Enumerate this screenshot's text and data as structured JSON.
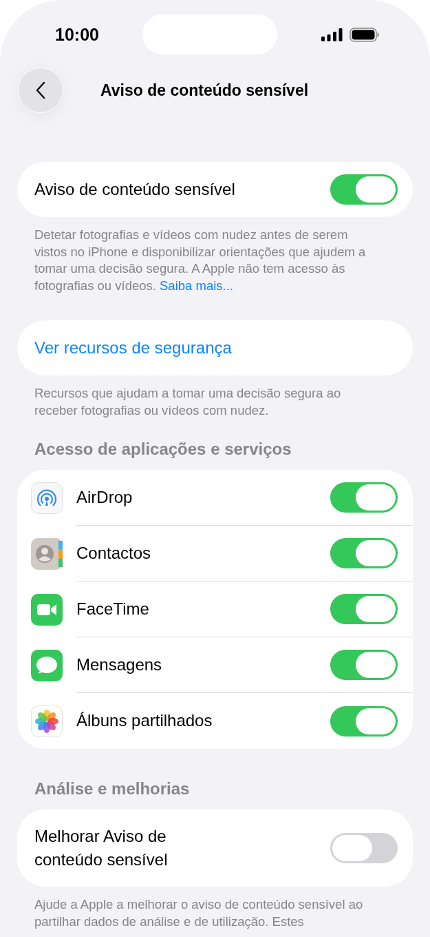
{
  "status_bar": {
    "time": "10:00"
  },
  "nav": {
    "title": "Aviso de conteúdo sensível"
  },
  "main_toggle": {
    "label": "Aviso de conteúdo sensível",
    "on": true
  },
  "main_footer": {
    "text": "Detetar fotografias e vídeos com nudez antes de serem vistos no iPhone e disponibilizar orientações que ajudem a tomar uma decisão segura. A Apple não tem acesso às fotografias ou vídeos.",
    "link": "Saiba mais..."
  },
  "resources": {
    "label": "Ver recursos de segurança"
  },
  "resources_footer": "Recursos que ajudam a tomar uma decisão segura ao receber fotografias ou vídeos com nudez.",
  "apps_section": {
    "header": "Acesso de aplicações e serviços",
    "items": [
      {
        "label": "AirDrop",
        "on": true
      },
      {
        "label": "Contactos",
        "on": true
      },
      {
        "label": "FaceTime",
        "on": true
      },
      {
        "label": "Mensagens",
        "on": true
      },
      {
        "label": "Álbuns partilhados",
        "on": true
      }
    ]
  },
  "analytics_section": {
    "header": "Análise e melhorias",
    "toggle": {
      "label": "Melhorar Aviso de conteúdo sensível",
      "on": false
    },
    "footer": "Ajude a Apple a melhorar o aviso de conteúdo sensível ao partilhar dados de análise e de utilização. Estes"
  }
}
